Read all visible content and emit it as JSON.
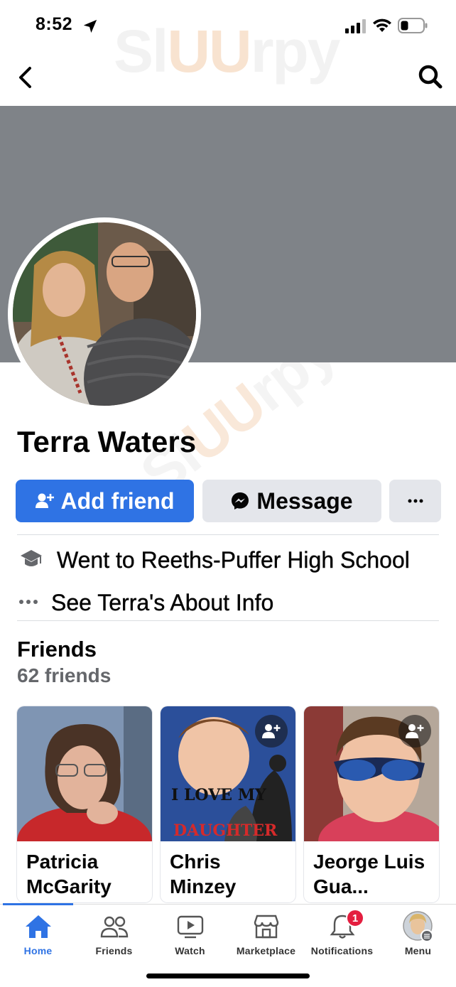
{
  "status_bar": {
    "time": "8:52"
  },
  "watermark": {
    "text_a": "Sl",
    "text_b": "UU",
    "text_c": "rpy"
  },
  "profile": {
    "name": "Terra Waters",
    "add_friend_label": "Add friend",
    "message_label": "Message",
    "more_label": "···"
  },
  "intro": {
    "education": "Went to Reeths-Puffer High School",
    "about": "See Terra's About Info"
  },
  "friends": {
    "title": "Friends",
    "count": "62 friends",
    "cards": [
      {
        "name": "Patricia McGarity"
      },
      {
        "name": "Chris Minzey",
        "photo_text": "I LOVE MY DAUGHTER"
      },
      {
        "name": "Jeorge Luis Gua..."
      }
    ]
  },
  "tabs": [
    {
      "label": "Home",
      "icon": "home-icon",
      "active": true
    },
    {
      "label": "Friends",
      "icon": "friends-icon"
    },
    {
      "label": "Watch",
      "icon": "watch-icon"
    },
    {
      "label": "Marketplace",
      "icon": "marketplace-icon"
    },
    {
      "label": "Notifications",
      "icon": "bell-icon",
      "badge": "1"
    },
    {
      "label": "Menu",
      "icon": "menu-avatar-icon"
    }
  ],
  "colors": {
    "accent": "#2f73e4",
    "cover": "#7f8388",
    "badge": "#e41e3f"
  }
}
